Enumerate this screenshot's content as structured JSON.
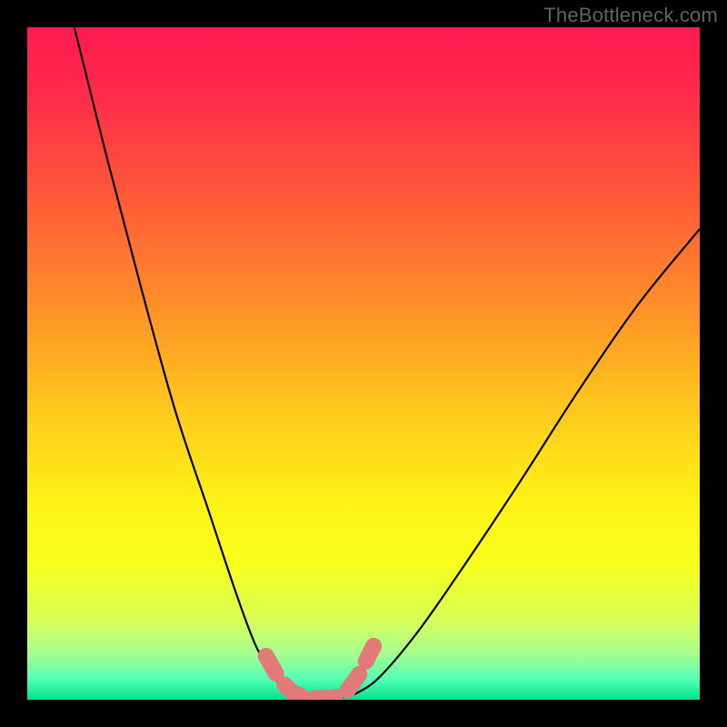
{
  "watermark": "TheBottleneck.com",
  "colors": {
    "page_bg": "#000000",
    "watermark": "#626262",
    "gradient_stops": [
      {
        "offset": 0.0,
        "color": "#ff1a50"
      },
      {
        "offset": 0.1,
        "color": "#ff2b4a"
      },
      {
        "offset": 0.25,
        "color": "#ff5839"
      },
      {
        "offset": 0.4,
        "color": "#ff8a2a"
      },
      {
        "offset": 0.55,
        "color": "#ffc21e"
      },
      {
        "offset": 0.7,
        "color": "#fff116"
      },
      {
        "offset": 0.8,
        "color": "#f6ff1c"
      },
      {
        "offset": 0.88,
        "color": "#d8ff55"
      },
      {
        "offset": 0.93,
        "color": "#a8ff8e"
      },
      {
        "offset": 0.97,
        "color": "#52ffb5"
      },
      {
        "offset": 1.0,
        "color": "#00e28a"
      }
    ],
    "curve_stroke": "#000000",
    "marker": "#e17a78"
  },
  "chart_data": {
    "type": "line",
    "title": "",
    "xlabel": "",
    "ylabel": "",
    "xlim": [
      0,
      1
    ],
    "ylim": [
      0,
      1
    ],
    "note": "Axis values are normalized to the plot box (0..1 in x, 0 at bottom to 1 at top). The image shows no numeric tick labels; values below describe the visible geometry.",
    "series": [
      {
        "name": "left-curve",
        "x": [
          0.07,
          0.12,
          0.17,
          0.22,
          0.27,
          0.31,
          0.34,
          0.37,
          0.39
        ],
        "y": [
          1.0,
          0.8,
          0.61,
          0.43,
          0.28,
          0.16,
          0.08,
          0.03,
          0.005
        ]
      },
      {
        "name": "valley-floor",
        "x": [
          0.39,
          0.42,
          0.45,
          0.48
        ],
        "y": [
          0.005,
          0.002,
          0.002,
          0.005
        ]
      },
      {
        "name": "right-curve",
        "x": [
          0.48,
          0.52,
          0.58,
          0.65,
          0.73,
          0.82,
          0.91,
          1.0
        ],
        "y": [
          0.005,
          0.03,
          0.1,
          0.2,
          0.32,
          0.46,
          0.59,
          0.7
        ]
      }
    ],
    "markers": {
      "name": "highlighted-points",
      "x": [
        0.355,
        0.375,
        0.395,
        0.415,
        0.435,
        0.455,
        0.475,
        0.495,
        0.515
      ],
      "y": [
        0.065,
        0.03,
        0.01,
        0.003,
        0.002,
        0.003,
        0.012,
        0.04,
        0.08
      ]
    }
  }
}
